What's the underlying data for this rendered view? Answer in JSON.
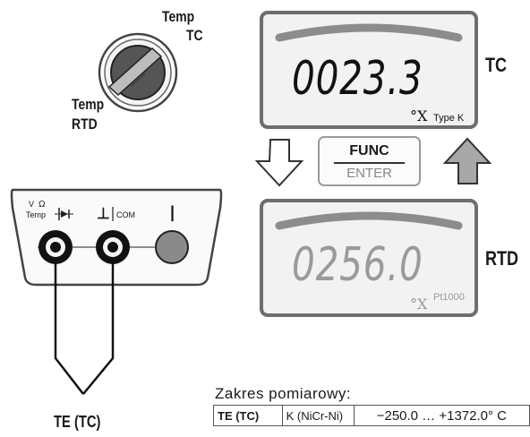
{
  "rotary_switch": {
    "label_tc_line1": "Temp",
    "label_tc_line2": "TC",
    "label_rtd_line1": "Temp",
    "label_rtd_line2": "RTD"
  },
  "display_tc": {
    "reading": "0023.3",
    "unit": "°X",
    "sensor_type": "Type K",
    "mode_label": "TC",
    "state": "active"
  },
  "display_rtd": {
    "reading": "0256.0",
    "unit": "°X",
    "sensor_type": "Pt1000",
    "mode_label": "RTD",
    "state": "inactive"
  },
  "func_key": {
    "top_label": "FUNC",
    "bottom_label": "ENTER"
  },
  "terminals": {
    "input_label_v": "V",
    "input_label_ohm": "Ω",
    "input_label_temp": "Temp",
    "com_symbol": "⊥",
    "com_label": "COM",
    "third_label": "|"
  },
  "probe_label": "TE (TC)",
  "range": {
    "title": "Zakres pomiarowy:",
    "rows": [
      {
        "sensor": "TE (TC)",
        "type": "K (NiCr-Ni)",
        "range": "−250.0 … +1372.0° C"
      }
    ]
  },
  "colors": {
    "lcd_border": "#6e6e6e",
    "lcd_arc": "#8c8c8c",
    "digits_active": "#111111",
    "digits_inactive": "#9a9a9a",
    "arrow_filled": "#a8a8a8",
    "button_gray": "#8a8a8a"
  }
}
